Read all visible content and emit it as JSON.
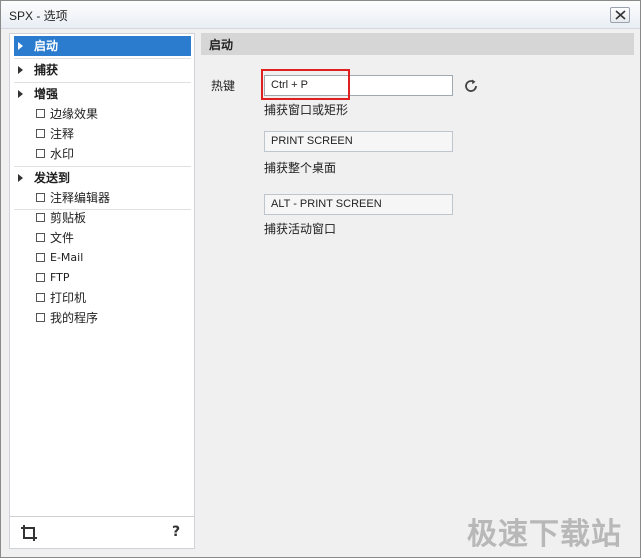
{
  "window": {
    "title": "SPX - 选项",
    "close_icon": "close-icon"
  },
  "nav": {
    "startup": "启动",
    "capture": "捕获",
    "enhance": "增强",
    "edge_effect": "边缘效果",
    "annotation": "注释",
    "watermark": "水印",
    "send_to": "发送到",
    "annotation_editor": "注释编辑器",
    "clipboard": "剪贴板",
    "file": "文件",
    "email": "E-Mail",
    "ftp": "FTP",
    "printer": "打印机",
    "my_program": "我的程序",
    "crop_icon": "crop-icon",
    "help_text": "?"
  },
  "content": {
    "header": "启动",
    "hotkey_label": "热键",
    "hotkey_window_value": "Ctrl + P",
    "hotkey_window_caption": "捕获窗口或矩形",
    "hotkey_desktop_value": "PRINT SCREEN",
    "hotkey_desktop_caption": "捕获整个桌面",
    "hotkey_active_value": "ALT - PRINT SCREEN",
    "hotkey_active_caption": "捕获活动窗口",
    "reset_icon": "refresh-icon"
  },
  "watermark": "极速下载站",
  "colors": {
    "selected": "#2b7bcf",
    "highlight": "#e02020",
    "header_bg": "#d6d6d6"
  }
}
